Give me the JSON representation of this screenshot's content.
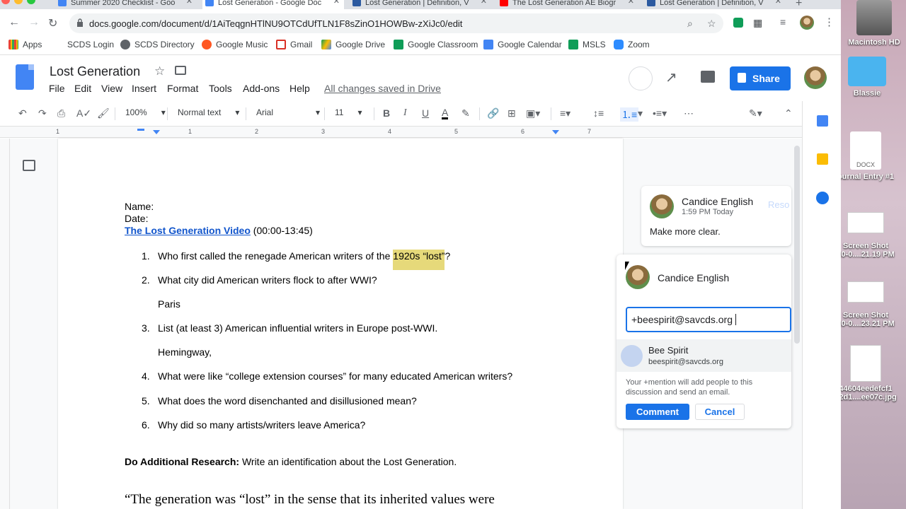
{
  "tabs": [
    {
      "label": "Summer 2020 Checklist - Goo",
      "active": false
    },
    {
      "label": "Lost Generation - Google Doc",
      "active": true
    },
    {
      "label": "Lost Generation | Definition, V",
      "active": false
    },
    {
      "label": "The Lost Generation AE Biogr",
      "active": false
    },
    {
      "label": "Lost Generation | Definition, V",
      "active": false
    }
  ],
  "address": {
    "url": "docs.google.com/document/d/1AiTeqgnHTlNU9OTCdUfTLN1F8sZinO1HOWBw-zXiJc0/edit"
  },
  "bookmarks": [
    "Apps",
    "SCDS Login",
    "SCDS Directory",
    "Google Music",
    "Gmail",
    "Google Drive",
    "Google Classroom",
    "Google Calendar",
    "MSLS",
    "Zoom"
  ],
  "docs": {
    "title": "Lost Generation",
    "menus": [
      "File",
      "Edit",
      "View",
      "Insert",
      "Format",
      "Tools",
      "Add-ons",
      "Help"
    ],
    "saved_status": "All changes saved in Drive",
    "share_label": "Share"
  },
  "toolbar": {
    "zoom": "100%",
    "style": "Normal text",
    "font": "Arial",
    "size": "11",
    "bold": "B",
    "italic": "I",
    "underline": "U",
    "text_color": "A"
  },
  "ruler": [
    "1",
    "1",
    "2",
    "3",
    "4",
    "5",
    "6",
    "7"
  ],
  "document": {
    "name_label": "Name:",
    "date_label": "Date:",
    "video_link": "The Lost Generation Video",
    "video_time": "(00:00-13:45)",
    "q1_num": "1.",
    "q1_text": "Who first called the renegade American writers of the ",
    "q1_highlight": "1920s “lost”",
    "q1_end": "?",
    "q2_num": "2.",
    "q2_text": "What city did American writers flock to after WWI?",
    "a2": "Paris",
    "q3_num": "3.",
    "q3_text": "List (at least 3) American influential writers in Europe post-WWI.",
    "a3": "Hemingway,",
    "q4_num": "4.",
    "q4_text": "What were like “college extension courses” for many educated American writers?",
    "q5_num": "5.",
    "q5_text": "What does the word disenchanted and disillusioned mean?",
    "q6_num": "6.",
    "q6_text": "Why did so many artists/writers leave America?",
    "research_bold": "Do Additional Research:",
    "research_text": " Write an identification about the Lost Generation.",
    "quote": "“The generation was “lost” in the sense that its inherited values were"
  },
  "comment1": {
    "author": "Candice English",
    "time": "1:59 PM Today",
    "text": "Make more clear.",
    "resolve": "Reso"
  },
  "comment2": {
    "author": "Candice English",
    "input_value": "+beespirit@savcds.org",
    "suggestion_name": "Bee Spirit",
    "suggestion_email": "beespirit@savcds.org",
    "hint": "Your +mention will add people to this discussion and send an email.",
    "comment_btn": "Comment",
    "cancel_btn": "Cancel"
  },
  "desktop": {
    "items": [
      "Macintosh HD",
      "Blassie",
      "ournal Entry #1",
      "Screen Shot",
      "20-0....21.19 PM",
      "Screen Shot",
      "20-0....23.21 PM",
      "44604eedefcf1",
      "92d1....ee07c.jpg"
    ],
    "docx_label": "DOCX"
  },
  "colors": {
    "accent": "#1a73e8",
    "highlight": "#e6d97a",
    "link": "#1155cc"
  }
}
